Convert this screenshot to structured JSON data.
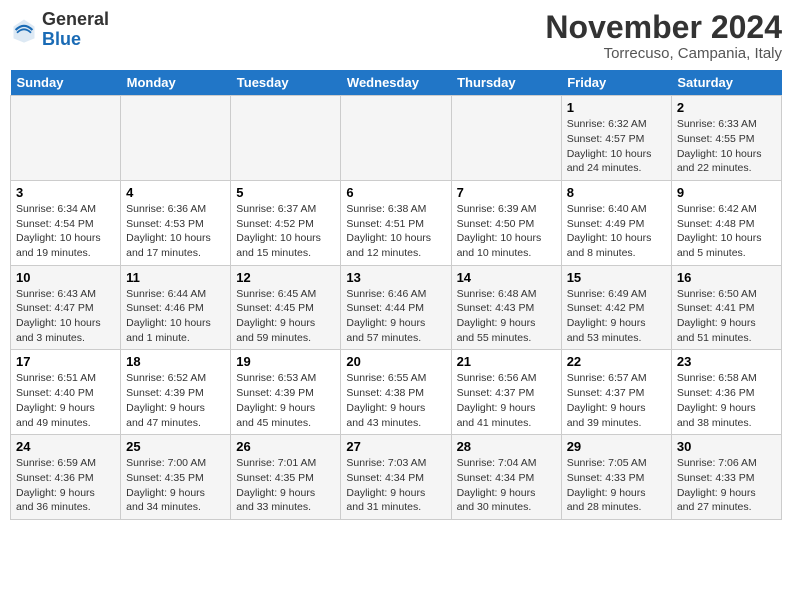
{
  "header": {
    "logo_general": "General",
    "logo_blue": "Blue",
    "month_title": "November 2024",
    "location": "Torrecuso, Campania, Italy"
  },
  "days_of_week": [
    "Sunday",
    "Monday",
    "Tuesday",
    "Wednesday",
    "Thursday",
    "Friday",
    "Saturday"
  ],
  "weeks": [
    [
      {
        "num": "",
        "info": ""
      },
      {
        "num": "",
        "info": ""
      },
      {
        "num": "",
        "info": ""
      },
      {
        "num": "",
        "info": ""
      },
      {
        "num": "",
        "info": ""
      },
      {
        "num": "1",
        "info": "Sunrise: 6:32 AM\nSunset: 4:57 PM\nDaylight: 10 hours and 24 minutes."
      },
      {
        "num": "2",
        "info": "Sunrise: 6:33 AM\nSunset: 4:55 PM\nDaylight: 10 hours and 22 minutes."
      }
    ],
    [
      {
        "num": "3",
        "info": "Sunrise: 6:34 AM\nSunset: 4:54 PM\nDaylight: 10 hours and 19 minutes."
      },
      {
        "num": "4",
        "info": "Sunrise: 6:36 AM\nSunset: 4:53 PM\nDaylight: 10 hours and 17 minutes."
      },
      {
        "num": "5",
        "info": "Sunrise: 6:37 AM\nSunset: 4:52 PM\nDaylight: 10 hours and 15 minutes."
      },
      {
        "num": "6",
        "info": "Sunrise: 6:38 AM\nSunset: 4:51 PM\nDaylight: 10 hours and 12 minutes."
      },
      {
        "num": "7",
        "info": "Sunrise: 6:39 AM\nSunset: 4:50 PM\nDaylight: 10 hours and 10 minutes."
      },
      {
        "num": "8",
        "info": "Sunrise: 6:40 AM\nSunset: 4:49 PM\nDaylight: 10 hours and 8 minutes."
      },
      {
        "num": "9",
        "info": "Sunrise: 6:42 AM\nSunset: 4:48 PM\nDaylight: 10 hours and 5 minutes."
      }
    ],
    [
      {
        "num": "10",
        "info": "Sunrise: 6:43 AM\nSunset: 4:47 PM\nDaylight: 10 hours and 3 minutes."
      },
      {
        "num": "11",
        "info": "Sunrise: 6:44 AM\nSunset: 4:46 PM\nDaylight: 10 hours and 1 minute."
      },
      {
        "num": "12",
        "info": "Sunrise: 6:45 AM\nSunset: 4:45 PM\nDaylight: 9 hours and 59 minutes."
      },
      {
        "num": "13",
        "info": "Sunrise: 6:46 AM\nSunset: 4:44 PM\nDaylight: 9 hours and 57 minutes."
      },
      {
        "num": "14",
        "info": "Sunrise: 6:48 AM\nSunset: 4:43 PM\nDaylight: 9 hours and 55 minutes."
      },
      {
        "num": "15",
        "info": "Sunrise: 6:49 AM\nSunset: 4:42 PM\nDaylight: 9 hours and 53 minutes."
      },
      {
        "num": "16",
        "info": "Sunrise: 6:50 AM\nSunset: 4:41 PM\nDaylight: 9 hours and 51 minutes."
      }
    ],
    [
      {
        "num": "17",
        "info": "Sunrise: 6:51 AM\nSunset: 4:40 PM\nDaylight: 9 hours and 49 minutes."
      },
      {
        "num": "18",
        "info": "Sunrise: 6:52 AM\nSunset: 4:39 PM\nDaylight: 9 hours and 47 minutes."
      },
      {
        "num": "19",
        "info": "Sunrise: 6:53 AM\nSunset: 4:39 PM\nDaylight: 9 hours and 45 minutes."
      },
      {
        "num": "20",
        "info": "Sunrise: 6:55 AM\nSunset: 4:38 PM\nDaylight: 9 hours and 43 minutes."
      },
      {
        "num": "21",
        "info": "Sunrise: 6:56 AM\nSunset: 4:37 PM\nDaylight: 9 hours and 41 minutes."
      },
      {
        "num": "22",
        "info": "Sunrise: 6:57 AM\nSunset: 4:37 PM\nDaylight: 9 hours and 39 minutes."
      },
      {
        "num": "23",
        "info": "Sunrise: 6:58 AM\nSunset: 4:36 PM\nDaylight: 9 hours and 38 minutes."
      }
    ],
    [
      {
        "num": "24",
        "info": "Sunrise: 6:59 AM\nSunset: 4:36 PM\nDaylight: 9 hours and 36 minutes."
      },
      {
        "num": "25",
        "info": "Sunrise: 7:00 AM\nSunset: 4:35 PM\nDaylight: 9 hours and 34 minutes."
      },
      {
        "num": "26",
        "info": "Sunrise: 7:01 AM\nSunset: 4:35 PM\nDaylight: 9 hours and 33 minutes."
      },
      {
        "num": "27",
        "info": "Sunrise: 7:03 AM\nSunset: 4:34 PM\nDaylight: 9 hours and 31 minutes."
      },
      {
        "num": "28",
        "info": "Sunrise: 7:04 AM\nSunset: 4:34 PM\nDaylight: 9 hours and 30 minutes."
      },
      {
        "num": "29",
        "info": "Sunrise: 7:05 AM\nSunset: 4:33 PM\nDaylight: 9 hours and 28 minutes."
      },
      {
        "num": "30",
        "info": "Sunrise: 7:06 AM\nSunset: 4:33 PM\nDaylight: 9 hours and 27 minutes."
      }
    ]
  ]
}
